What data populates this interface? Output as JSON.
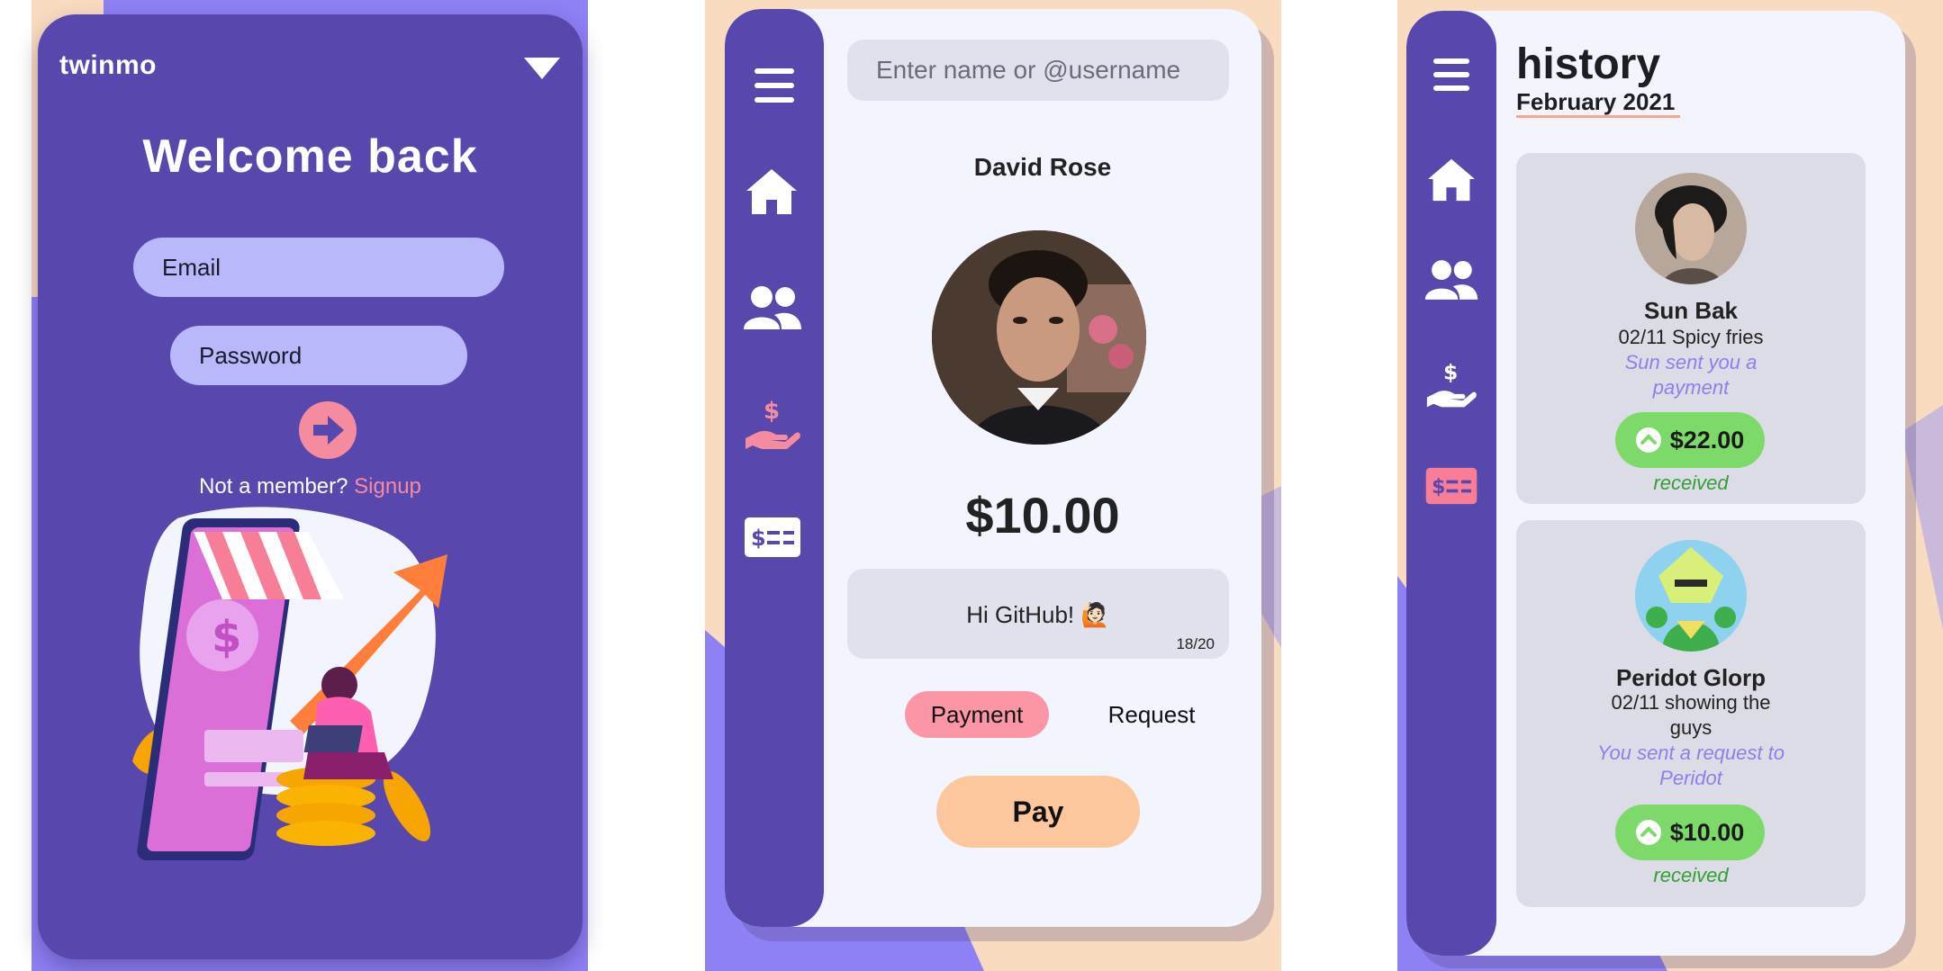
{
  "login": {
    "logo": "twinmo",
    "heading": "Welcome back",
    "email_placeholder": "Email",
    "password_placeholder": "Password",
    "not_member": "Not a member?",
    "signup_link": "Signup"
  },
  "pay": {
    "search_placeholder": "Enter name or @username",
    "recipient": "David Rose",
    "amount": "$10.00",
    "note": "Hi GitHub! 🙋🏻",
    "char_count": "18/20",
    "tab_payment": "Payment",
    "tab_request": "Request",
    "pay_button": "Pay"
  },
  "history": {
    "title": "history",
    "month": "February 2021",
    "transactions": [
      {
        "name": "Sun Bak",
        "memo": "02/11 Spicy fries",
        "desc_line1": "Sun sent you a",
        "desc_line2": "payment",
        "amount": "$22.00",
        "status": "received"
      },
      {
        "name": "Peridot Glorp",
        "memo_line1": "02/11 showing the",
        "memo_line2": "guys",
        "desc_line1": "You sent a request to",
        "desc_line2": "Peridot",
        "amount": "$10.00",
        "status": "received"
      }
    ]
  },
  "nav_icons": [
    "menu-icon",
    "home-icon",
    "users-icon",
    "pay-hand-icon",
    "history-card-icon"
  ],
  "colors": {
    "primary_purple": "#5848ae",
    "accent_pink": "#f58b9f",
    "accent_peach": "#fdc79e",
    "lavender": "#b8b8fb",
    "success_green": "#7dd96a"
  }
}
